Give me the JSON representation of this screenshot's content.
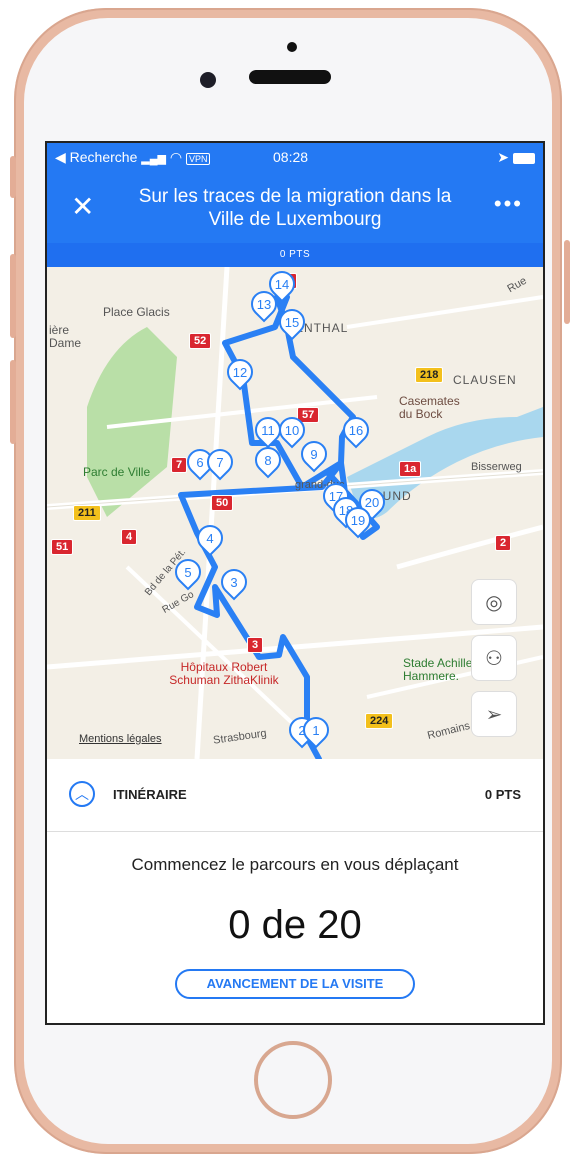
{
  "status": {
    "back": "◀ Recherche",
    "vpn": "VPN",
    "time": "08:28"
  },
  "header": {
    "close": "✕",
    "title": "Sur les traces de la migration dans la Ville de Luxembourg",
    "more": "•••"
  },
  "pts_bar": "0 PTS",
  "map": {
    "labels": [
      "Place Glacis",
      "ière",
      "Dame",
      "Parc de Ville",
      "CLAUSEN",
      "Casemates du Bock",
      "Bisserweg",
      "Stade Achille Hammere.",
      "Hôpitaux Robert Schuman ZithaKlinik",
      "Bd de la Pét.",
      "Rue Go",
      "Strasbourg",
      "Romains",
      "ENTHAL",
      "grand-duc",
      "RUND",
      "Rue"
    ],
    "road_badges": [
      "51",
      "52",
      "218",
      "57",
      "7",
      "50",
      "211",
      "4",
      "1a",
      "2",
      "224",
      "3"
    ],
    "markers": [
      "14",
      "13",
      "15",
      "12",
      "11",
      "10",
      "16",
      "9",
      "8",
      "6",
      "7",
      "17",
      "18",
      "20",
      "19",
      "4",
      "5",
      "3",
      "2",
      "1"
    ],
    "mentions": "Mentions légales",
    "buttons": [
      "compass-button",
      "binoculars-button",
      "locate-button"
    ]
  },
  "itinerary": {
    "label": "ITINÉRAIRE",
    "points": "0 PTS"
  },
  "progress": {
    "message": "Commencez le parcours en vous déplaçant",
    "count": "0 de 20",
    "button": "AVANCEMENT DE LA VISITE"
  },
  "colors": {
    "accent": "#2479f3",
    "route": "#2a80f4"
  }
}
